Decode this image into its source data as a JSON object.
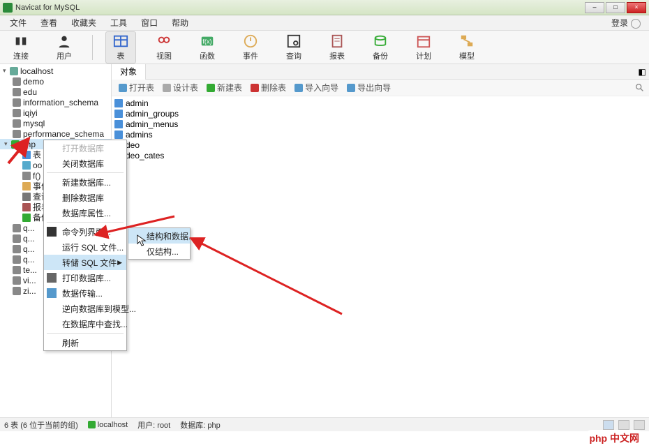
{
  "title": "Navicat for MySQL",
  "menu": {
    "file": "文件",
    "view": "查看",
    "favorites": "收藏夹",
    "tools": "工具",
    "window": "窗口",
    "help": "帮助",
    "login": "登录"
  },
  "toolbar": {
    "connection": "连接",
    "user": "用户",
    "table": "表",
    "view": "视图",
    "function": "函数",
    "event": "事件",
    "query": "查询",
    "report": "报表",
    "backup": "备份",
    "schedule": "计划",
    "model": "模型"
  },
  "tree": {
    "server": "localhost",
    "databases": [
      "demo",
      "edu",
      "information_schema",
      "iqiyi",
      "mysql",
      "performance_schema"
    ],
    "selected_db": "php",
    "selected_children": [
      "表",
      "oo 视图",
      "f() 函数",
      "事件",
      "查询",
      "报表",
      "备份"
    ],
    "trailing": [
      "q...",
      "q...",
      "q...",
      "q...",
      "te...",
      "vi...",
      "zi..."
    ]
  },
  "tabs": {
    "objects": "对象"
  },
  "subtoolbar": {
    "open": "打开表",
    "design": "设计表",
    "new": "新建表",
    "delete": "删除表",
    "import": "导入向导",
    "export": "导出向导"
  },
  "tables": [
    "admin",
    "admin_groups",
    "admin_menus",
    "admins",
    "deo",
    "deo_cates"
  ],
  "context_menu": {
    "open_db": "打开数据库",
    "close_db": "关闭数据库",
    "new_db": "新建数据库...",
    "delete_db": "删除数据库",
    "db_props": "数据库属性...",
    "cli": "命令列界面...",
    "run_sql": "运行 SQL 文件...",
    "dump_sql": "转储 SQL 文件",
    "print_db": "打印数据库...",
    "data_transfer": "数据传输...",
    "reverse_model": "逆向数据库到模型...",
    "find_in_db": "在数据库中查找...",
    "refresh": "刷新"
  },
  "submenu": {
    "struct_data": "结构和数据...",
    "struct_only": "仅结构..."
  },
  "status": {
    "count": "6 表 (6 位于当前的组)",
    "conn": "localhost",
    "user_label": "用户:",
    "user": "root",
    "db_label": "数据库:",
    "db": "php"
  },
  "watermark": "php 中文网"
}
